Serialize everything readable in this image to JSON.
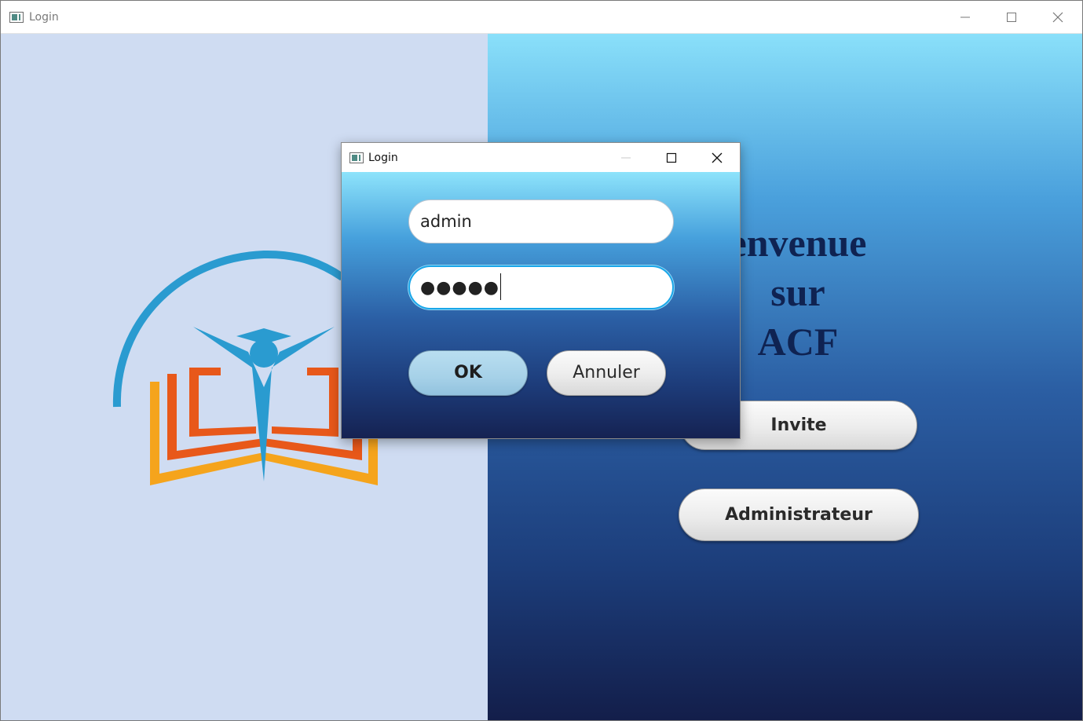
{
  "window": {
    "title": "Login",
    "icon": "app-window-icon",
    "controls": [
      "minimize-icon",
      "maximize-icon",
      "close-icon"
    ]
  },
  "welcome": {
    "lines": [
      "envenue",
      "sur",
      "ACF"
    ]
  },
  "buttons": {
    "invite_label": "Invite",
    "admin_label": "Administrateur"
  },
  "dialog": {
    "title": "Login",
    "username_value": "admin",
    "password_mask": "●●●●●",
    "ok_label": "OK",
    "cancel_label": "Annuler"
  },
  "colors": {
    "left_panel": "#cfdcf2",
    "right_gradient_top": "#8ae0fa",
    "right_gradient_bottom": "#131e4a",
    "logo_blue": "#2a9bd0",
    "logo_orange": "#e8581a",
    "logo_yellow": "#f5a41c",
    "title_text": "#0f2352",
    "focus_ring": "#1aa6e8"
  }
}
